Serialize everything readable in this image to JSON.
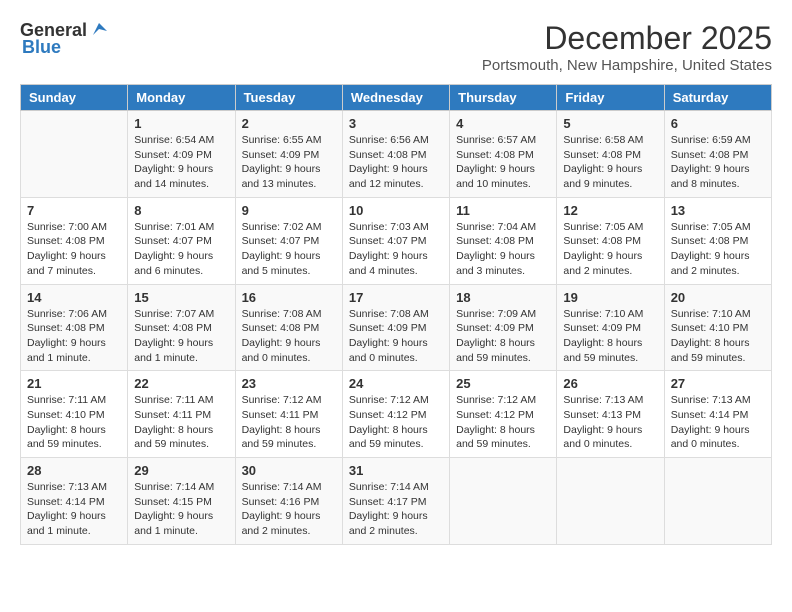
{
  "header": {
    "logo_general": "General",
    "logo_blue": "Blue",
    "month_year": "December 2025",
    "location": "Portsmouth, New Hampshire, United States"
  },
  "weekdays": [
    "Sunday",
    "Monday",
    "Tuesday",
    "Wednesday",
    "Thursday",
    "Friday",
    "Saturday"
  ],
  "weeks": [
    [
      {
        "day": "",
        "info": ""
      },
      {
        "day": "1",
        "info": "Sunrise: 6:54 AM\nSunset: 4:09 PM\nDaylight: 9 hours\nand 14 minutes."
      },
      {
        "day": "2",
        "info": "Sunrise: 6:55 AM\nSunset: 4:09 PM\nDaylight: 9 hours\nand 13 minutes."
      },
      {
        "day": "3",
        "info": "Sunrise: 6:56 AM\nSunset: 4:08 PM\nDaylight: 9 hours\nand 12 minutes."
      },
      {
        "day": "4",
        "info": "Sunrise: 6:57 AM\nSunset: 4:08 PM\nDaylight: 9 hours\nand 10 minutes."
      },
      {
        "day": "5",
        "info": "Sunrise: 6:58 AM\nSunset: 4:08 PM\nDaylight: 9 hours\nand 9 minutes."
      },
      {
        "day": "6",
        "info": "Sunrise: 6:59 AM\nSunset: 4:08 PM\nDaylight: 9 hours\nand 8 minutes."
      }
    ],
    [
      {
        "day": "7",
        "info": "Sunrise: 7:00 AM\nSunset: 4:08 PM\nDaylight: 9 hours\nand 7 minutes."
      },
      {
        "day": "8",
        "info": "Sunrise: 7:01 AM\nSunset: 4:07 PM\nDaylight: 9 hours\nand 6 minutes."
      },
      {
        "day": "9",
        "info": "Sunrise: 7:02 AM\nSunset: 4:07 PM\nDaylight: 9 hours\nand 5 minutes."
      },
      {
        "day": "10",
        "info": "Sunrise: 7:03 AM\nSunset: 4:07 PM\nDaylight: 9 hours\nand 4 minutes."
      },
      {
        "day": "11",
        "info": "Sunrise: 7:04 AM\nSunset: 4:08 PM\nDaylight: 9 hours\nand 3 minutes."
      },
      {
        "day": "12",
        "info": "Sunrise: 7:05 AM\nSunset: 4:08 PM\nDaylight: 9 hours\nand 2 minutes."
      },
      {
        "day": "13",
        "info": "Sunrise: 7:05 AM\nSunset: 4:08 PM\nDaylight: 9 hours\nand 2 minutes."
      }
    ],
    [
      {
        "day": "14",
        "info": "Sunrise: 7:06 AM\nSunset: 4:08 PM\nDaylight: 9 hours\nand 1 minute."
      },
      {
        "day": "15",
        "info": "Sunrise: 7:07 AM\nSunset: 4:08 PM\nDaylight: 9 hours\nand 1 minute."
      },
      {
        "day": "16",
        "info": "Sunrise: 7:08 AM\nSunset: 4:08 PM\nDaylight: 9 hours\nand 0 minutes."
      },
      {
        "day": "17",
        "info": "Sunrise: 7:08 AM\nSunset: 4:09 PM\nDaylight: 9 hours\nand 0 minutes."
      },
      {
        "day": "18",
        "info": "Sunrise: 7:09 AM\nSunset: 4:09 PM\nDaylight: 8 hours\nand 59 minutes."
      },
      {
        "day": "19",
        "info": "Sunrise: 7:10 AM\nSunset: 4:09 PM\nDaylight: 8 hours\nand 59 minutes."
      },
      {
        "day": "20",
        "info": "Sunrise: 7:10 AM\nSunset: 4:10 PM\nDaylight: 8 hours\nand 59 minutes."
      }
    ],
    [
      {
        "day": "21",
        "info": "Sunrise: 7:11 AM\nSunset: 4:10 PM\nDaylight: 8 hours\nand 59 minutes."
      },
      {
        "day": "22",
        "info": "Sunrise: 7:11 AM\nSunset: 4:11 PM\nDaylight: 8 hours\nand 59 minutes."
      },
      {
        "day": "23",
        "info": "Sunrise: 7:12 AM\nSunset: 4:11 PM\nDaylight: 8 hours\nand 59 minutes."
      },
      {
        "day": "24",
        "info": "Sunrise: 7:12 AM\nSunset: 4:12 PM\nDaylight: 8 hours\nand 59 minutes."
      },
      {
        "day": "25",
        "info": "Sunrise: 7:12 AM\nSunset: 4:12 PM\nDaylight: 8 hours\nand 59 minutes."
      },
      {
        "day": "26",
        "info": "Sunrise: 7:13 AM\nSunset: 4:13 PM\nDaylight: 9 hours\nand 0 minutes."
      },
      {
        "day": "27",
        "info": "Sunrise: 7:13 AM\nSunset: 4:14 PM\nDaylight: 9 hours\nand 0 minutes."
      }
    ],
    [
      {
        "day": "28",
        "info": "Sunrise: 7:13 AM\nSunset: 4:14 PM\nDaylight: 9 hours\nand 1 minute."
      },
      {
        "day": "29",
        "info": "Sunrise: 7:14 AM\nSunset: 4:15 PM\nDaylight: 9 hours\nand 1 minute."
      },
      {
        "day": "30",
        "info": "Sunrise: 7:14 AM\nSunset: 4:16 PM\nDaylight: 9 hours\nand 2 minutes."
      },
      {
        "day": "31",
        "info": "Sunrise: 7:14 AM\nSunset: 4:17 PM\nDaylight: 9 hours\nand 2 minutes."
      },
      {
        "day": "",
        "info": ""
      },
      {
        "day": "",
        "info": ""
      },
      {
        "day": "",
        "info": ""
      }
    ]
  ]
}
